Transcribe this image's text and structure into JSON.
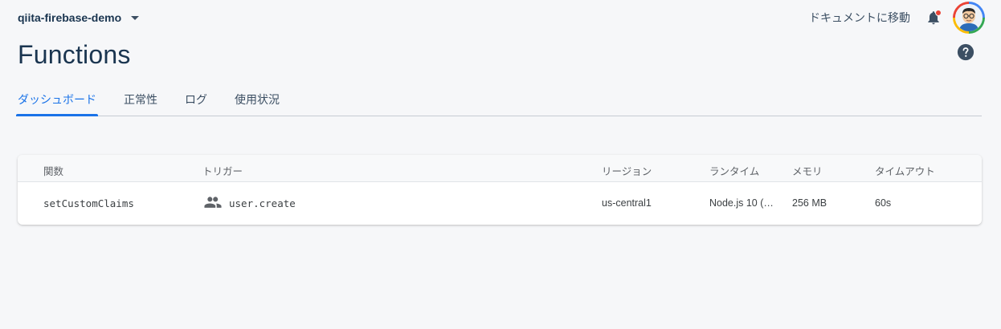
{
  "header": {
    "project_name": "qiita-firebase-demo",
    "docs_link": "ドキュメントに移動",
    "notification_dot_color": "#e94235"
  },
  "page": {
    "title": "Functions"
  },
  "tabs": [
    {
      "label": "ダッシュボード",
      "active": true
    },
    {
      "label": "正常性",
      "active": false
    },
    {
      "label": "ログ",
      "active": false
    },
    {
      "label": "使用状況",
      "active": false
    }
  ],
  "table": {
    "columns": [
      "関数",
      "トリガー",
      "リージョン",
      "ランタイム",
      "メモリ",
      "タイムアウト"
    ],
    "rows": [
      {
        "function": "setCustomClaims",
        "trigger_icon": "people-icon",
        "trigger": "user.create",
        "region": "us-central1",
        "runtime": "Node.js 10 (…",
        "memory": "256 MB",
        "timeout": "60s"
      }
    ]
  },
  "colors": {
    "accent": "#1a73e8",
    "title": "#1a3550",
    "background": "#f6f7f9"
  }
}
